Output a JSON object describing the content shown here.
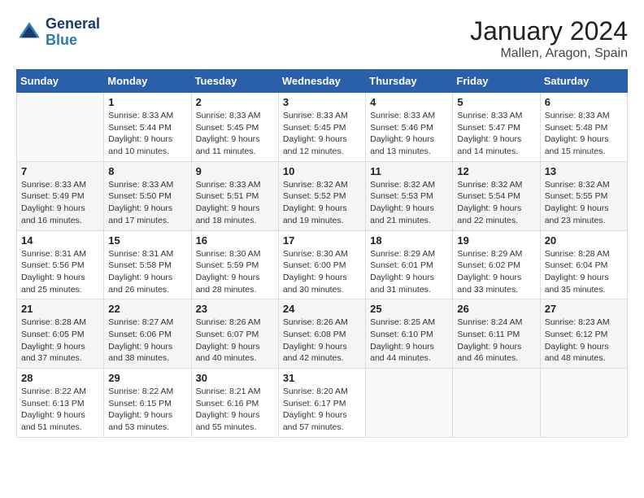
{
  "logo": {
    "line1": "General",
    "line2": "Blue"
  },
  "title": "January 2024",
  "location": "Mallen, Aragon, Spain",
  "days_of_week": [
    "Sunday",
    "Monday",
    "Tuesday",
    "Wednesday",
    "Thursday",
    "Friday",
    "Saturday"
  ],
  "weeks": [
    [
      {
        "day": "",
        "sunrise": "",
        "sunset": "",
        "daylight": ""
      },
      {
        "day": "1",
        "sunrise": "Sunrise: 8:33 AM",
        "sunset": "Sunset: 5:44 PM",
        "daylight": "Daylight: 9 hours and 10 minutes."
      },
      {
        "day": "2",
        "sunrise": "Sunrise: 8:33 AM",
        "sunset": "Sunset: 5:45 PM",
        "daylight": "Daylight: 9 hours and 11 minutes."
      },
      {
        "day": "3",
        "sunrise": "Sunrise: 8:33 AM",
        "sunset": "Sunset: 5:45 PM",
        "daylight": "Daylight: 9 hours and 12 minutes."
      },
      {
        "day": "4",
        "sunrise": "Sunrise: 8:33 AM",
        "sunset": "Sunset: 5:46 PM",
        "daylight": "Daylight: 9 hours and 13 minutes."
      },
      {
        "day": "5",
        "sunrise": "Sunrise: 8:33 AM",
        "sunset": "Sunset: 5:47 PM",
        "daylight": "Daylight: 9 hours and 14 minutes."
      },
      {
        "day": "6",
        "sunrise": "Sunrise: 8:33 AM",
        "sunset": "Sunset: 5:48 PM",
        "daylight": "Daylight: 9 hours and 15 minutes."
      }
    ],
    [
      {
        "day": "7",
        "sunrise": "Sunrise: 8:33 AM",
        "sunset": "Sunset: 5:49 PM",
        "daylight": "Daylight: 9 hours and 16 minutes."
      },
      {
        "day": "8",
        "sunrise": "Sunrise: 8:33 AM",
        "sunset": "Sunset: 5:50 PM",
        "daylight": "Daylight: 9 hours and 17 minutes."
      },
      {
        "day": "9",
        "sunrise": "Sunrise: 8:33 AM",
        "sunset": "Sunset: 5:51 PM",
        "daylight": "Daylight: 9 hours and 18 minutes."
      },
      {
        "day": "10",
        "sunrise": "Sunrise: 8:32 AM",
        "sunset": "Sunset: 5:52 PM",
        "daylight": "Daylight: 9 hours and 19 minutes."
      },
      {
        "day": "11",
        "sunrise": "Sunrise: 8:32 AM",
        "sunset": "Sunset: 5:53 PM",
        "daylight": "Daylight: 9 hours and 21 minutes."
      },
      {
        "day": "12",
        "sunrise": "Sunrise: 8:32 AM",
        "sunset": "Sunset: 5:54 PM",
        "daylight": "Daylight: 9 hours and 22 minutes."
      },
      {
        "day": "13",
        "sunrise": "Sunrise: 8:32 AM",
        "sunset": "Sunset: 5:55 PM",
        "daylight": "Daylight: 9 hours and 23 minutes."
      }
    ],
    [
      {
        "day": "14",
        "sunrise": "Sunrise: 8:31 AM",
        "sunset": "Sunset: 5:56 PM",
        "daylight": "Daylight: 9 hours and 25 minutes."
      },
      {
        "day": "15",
        "sunrise": "Sunrise: 8:31 AM",
        "sunset": "Sunset: 5:58 PM",
        "daylight": "Daylight: 9 hours and 26 minutes."
      },
      {
        "day": "16",
        "sunrise": "Sunrise: 8:30 AM",
        "sunset": "Sunset: 5:59 PM",
        "daylight": "Daylight: 9 hours and 28 minutes."
      },
      {
        "day": "17",
        "sunrise": "Sunrise: 8:30 AM",
        "sunset": "Sunset: 6:00 PM",
        "daylight": "Daylight: 9 hours and 30 minutes."
      },
      {
        "day": "18",
        "sunrise": "Sunrise: 8:29 AM",
        "sunset": "Sunset: 6:01 PM",
        "daylight": "Daylight: 9 hours and 31 minutes."
      },
      {
        "day": "19",
        "sunrise": "Sunrise: 8:29 AM",
        "sunset": "Sunset: 6:02 PM",
        "daylight": "Daylight: 9 hours and 33 minutes."
      },
      {
        "day": "20",
        "sunrise": "Sunrise: 8:28 AM",
        "sunset": "Sunset: 6:04 PM",
        "daylight": "Daylight: 9 hours and 35 minutes."
      }
    ],
    [
      {
        "day": "21",
        "sunrise": "Sunrise: 8:28 AM",
        "sunset": "Sunset: 6:05 PM",
        "daylight": "Daylight: 9 hours and 37 minutes."
      },
      {
        "day": "22",
        "sunrise": "Sunrise: 8:27 AM",
        "sunset": "Sunset: 6:06 PM",
        "daylight": "Daylight: 9 hours and 38 minutes."
      },
      {
        "day": "23",
        "sunrise": "Sunrise: 8:26 AM",
        "sunset": "Sunset: 6:07 PM",
        "daylight": "Daylight: 9 hours and 40 minutes."
      },
      {
        "day": "24",
        "sunrise": "Sunrise: 8:26 AM",
        "sunset": "Sunset: 6:08 PM",
        "daylight": "Daylight: 9 hours and 42 minutes."
      },
      {
        "day": "25",
        "sunrise": "Sunrise: 8:25 AM",
        "sunset": "Sunset: 6:10 PM",
        "daylight": "Daylight: 9 hours and 44 minutes."
      },
      {
        "day": "26",
        "sunrise": "Sunrise: 8:24 AM",
        "sunset": "Sunset: 6:11 PM",
        "daylight": "Daylight: 9 hours and 46 minutes."
      },
      {
        "day": "27",
        "sunrise": "Sunrise: 8:23 AM",
        "sunset": "Sunset: 6:12 PM",
        "daylight": "Daylight: 9 hours and 48 minutes."
      }
    ],
    [
      {
        "day": "28",
        "sunrise": "Sunrise: 8:22 AM",
        "sunset": "Sunset: 6:13 PM",
        "daylight": "Daylight: 9 hours and 51 minutes."
      },
      {
        "day": "29",
        "sunrise": "Sunrise: 8:22 AM",
        "sunset": "Sunset: 6:15 PM",
        "daylight": "Daylight: 9 hours and 53 minutes."
      },
      {
        "day": "30",
        "sunrise": "Sunrise: 8:21 AM",
        "sunset": "Sunset: 6:16 PM",
        "daylight": "Daylight: 9 hours and 55 minutes."
      },
      {
        "day": "31",
        "sunrise": "Sunrise: 8:20 AM",
        "sunset": "Sunset: 6:17 PM",
        "daylight": "Daylight: 9 hours and 57 minutes."
      },
      {
        "day": "",
        "sunrise": "",
        "sunset": "",
        "daylight": ""
      },
      {
        "day": "",
        "sunrise": "",
        "sunset": "",
        "daylight": ""
      },
      {
        "day": "",
        "sunrise": "",
        "sunset": "",
        "daylight": ""
      }
    ]
  ]
}
